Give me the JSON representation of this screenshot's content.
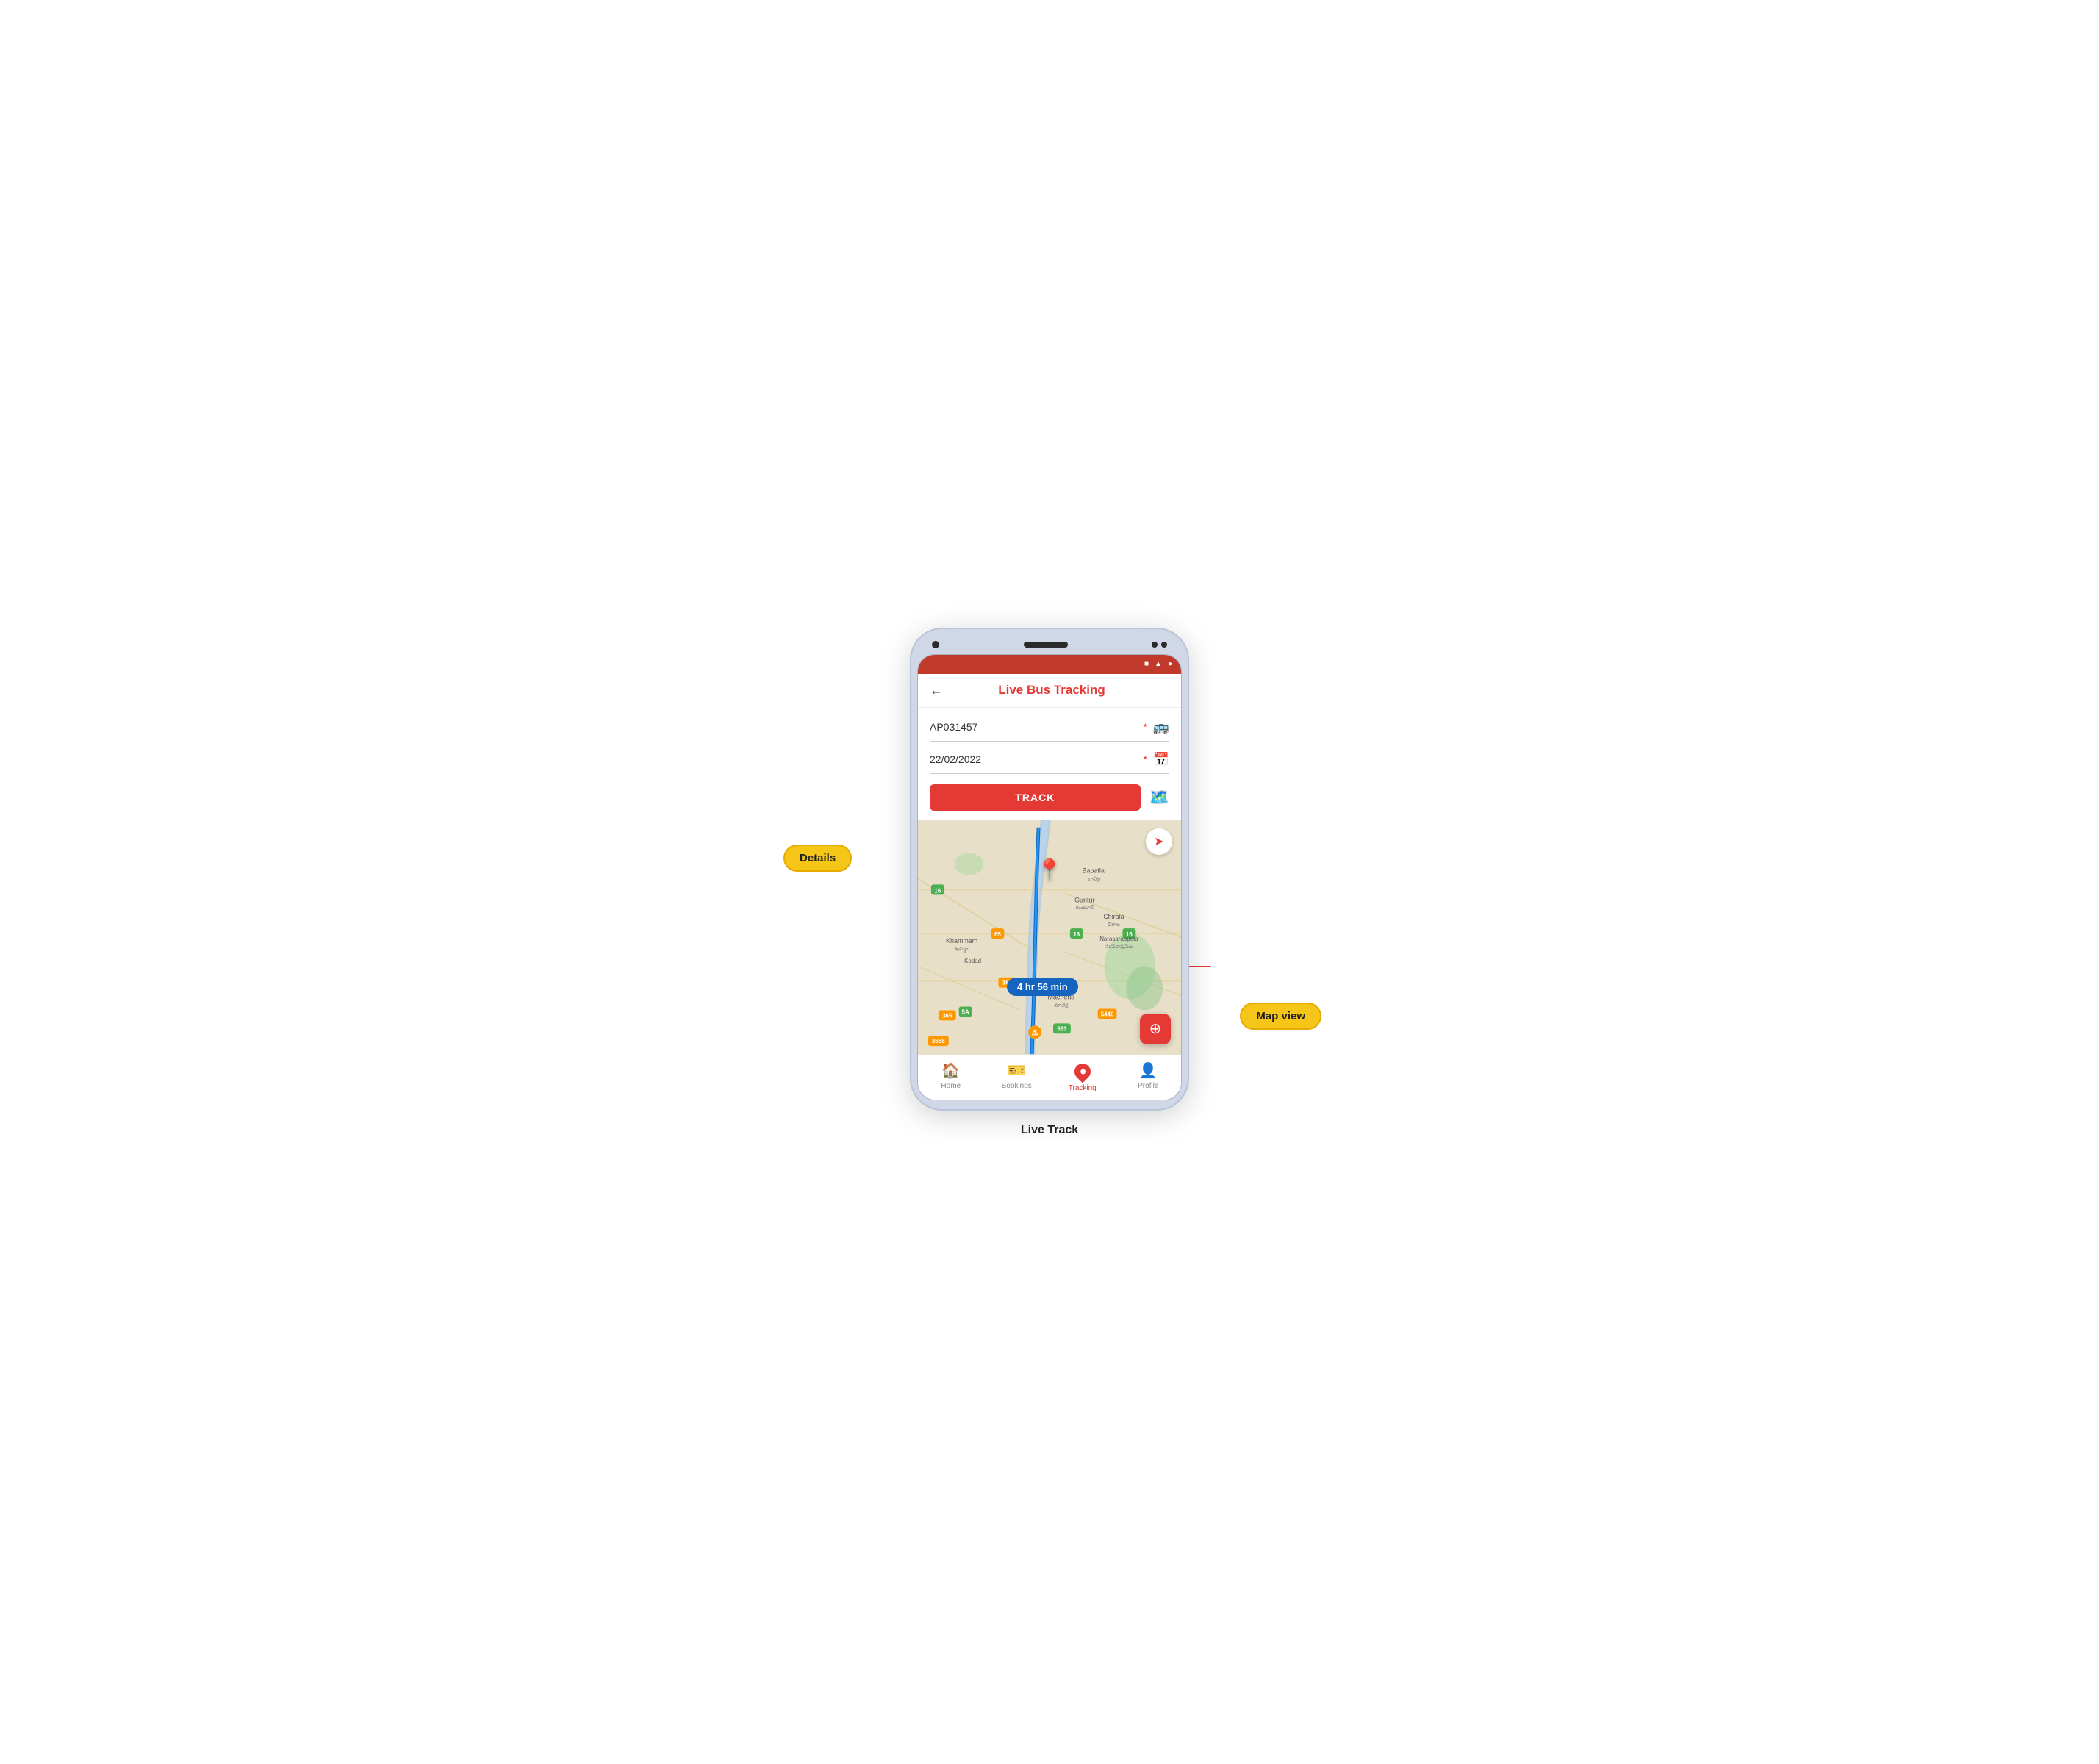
{
  "page": {
    "caption": "Live Track"
  },
  "status_bar": {
    "icons": [
      "square",
      "triangle",
      "circle"
    ]
  },
  "header": {
    "back_label": "←",
    "title": "Live Bus Tracking"
  },
  "form": {
    "bus_number": {
      "value": "AP031457",
      "placeholder": "AP031457",
      "required_marker": "*"
    },
    "date": {
      "value": "22/02/2022",
      "placeholder": "22/02/2022",
      "required_marker": "*"
    },
    "track_button_label": "TRACK"
  },
  "map": {
    "time_badge": "4 hr 56 min"
  },
  "bottom_nav": {
    "items": [
      {
        "id": "home",
        "label": "Home",
        "icon": "🏠",
        "active": false
      },
      {
        "id": "bookings",
        "label": "Bookings",
        "icon": "🚌",
        "active": false
      },
      {
        "id": "tracking",
        "label": "Tracking",
        "icon": "pin",
        "active": true
      },
      {
        "id": "profile",
        "label": "Profile",
        "icon": "👤",
        "active": false
      }
    ]
  },
  "callouts": {
    "details": "Details",
    "map_view": "Map view"
  },
  "colors": {
    "primary_red": "#e53935",
    "nav_active": "#e53935",
    "nav_inactive": "#888888",
    "status_bar_bg": "#c0392b",
    "callout_bg": "#f5c518"
  }
}
